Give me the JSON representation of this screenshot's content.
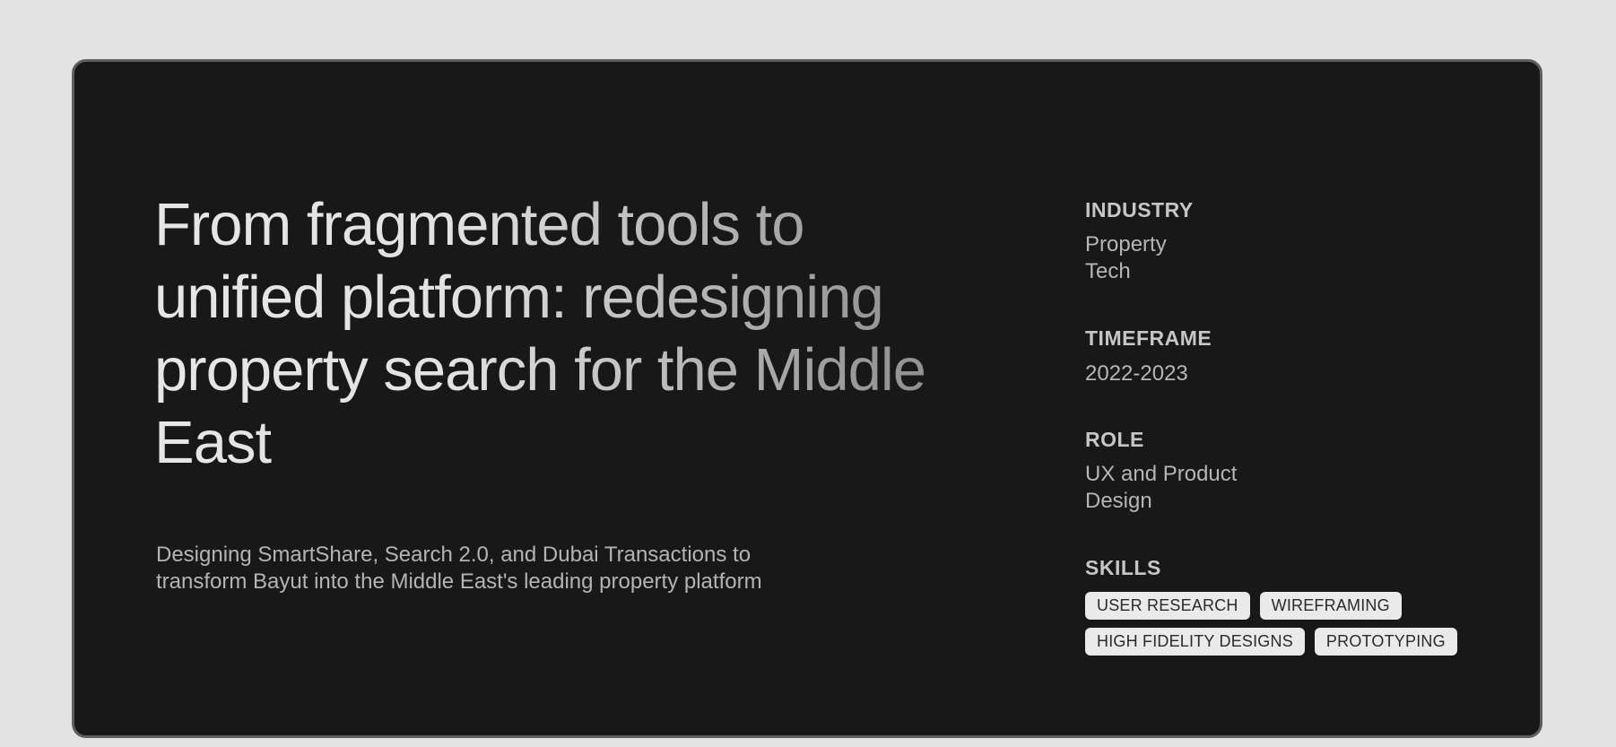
{
  "hero": {
    "title": "From fragmented tools to unified platform: redesigning property search for the Middle East",
    "subtitle": "Designing SmartShare, Search 2.0, and Dubai Transactions to transform Bayut into the Middle East's leading property platform"
  },
  "meta": {
    "industry": {
      "label": "INDUSTRY",
      "value": "Property Tech"
    },
    "timeframe": {
      "label": "TIMEFRAME",
      "value": "2022-2023"
    },
    "role": {
      "label": "ROLE",
      "value": "UX and Product Design"
    },
    "skills": {
      "label": "SKILLS",
      "items": [
        "USER RESEARCH",
        "WIREFRAMING",
        "HIGH FIDELITY DESIGNS",
        "PROTOTYPING"
      ]
    }
  },
  "colors": {
    "page_background": "#e3e3e3",
    "card_background": "#181818",
    "card_border": "#5e5e5e",
    "chip_background": "#eaeaea"
  }
}
